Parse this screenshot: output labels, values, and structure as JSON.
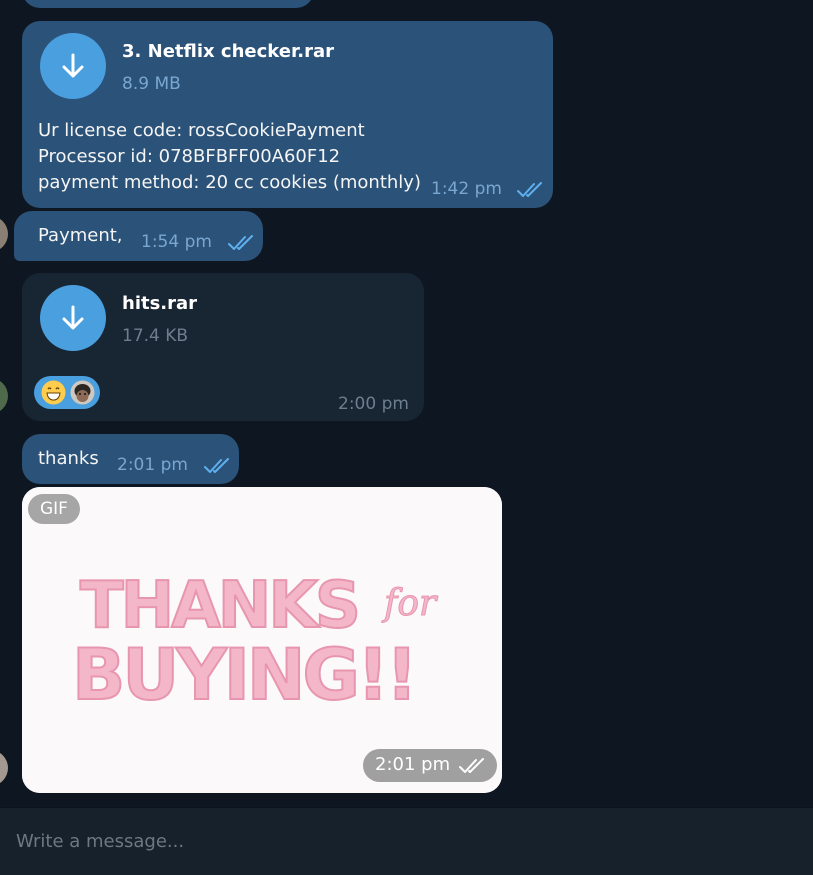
{
  "messages": [
    {
      "file_name": "3. Netflix checker.rar",
      "file_size": "8.9 MB",
      "text_lines": [
        "Ur license code: rossCookiePayment",
        "Processor id: 078BFBFF00A60F12",
        "payment method: 20 cc cookies (monthly)"
      ],
      "time": "1:42 pm"
    },
    {
      "text": "Payment,",
      "time": "1:54 pm"
    },
    {
      "file_name": "hits.rar",
      "file_size": "17.4 KB",
      "reactions": [
        "grinning-emoji",
        "user-avatar"
      ],
      "time": "2:00 pm"
    },
    {
      "text": "thanks",
      "time": "2:01 pm"
    },
    {
      "gif_badge": "GIF",
      "gif_text_line1": "THANKS",
      "gif_text_for": "for",
      "gif_text_line2": "BUYING!!",
      "time": "2:01 pm"
    }
  ],
  "composer": {
    "placeholder": "Write a message..."
  },
  "colors": {
    "background": "#0e1621",
    "outgoing_bubble": "#2b5278",
    "incoming_bubble": "#182533",
    "accent": "#4a9fdf",
    "gif_text_pink": "#f4b6c9"
  }
}
